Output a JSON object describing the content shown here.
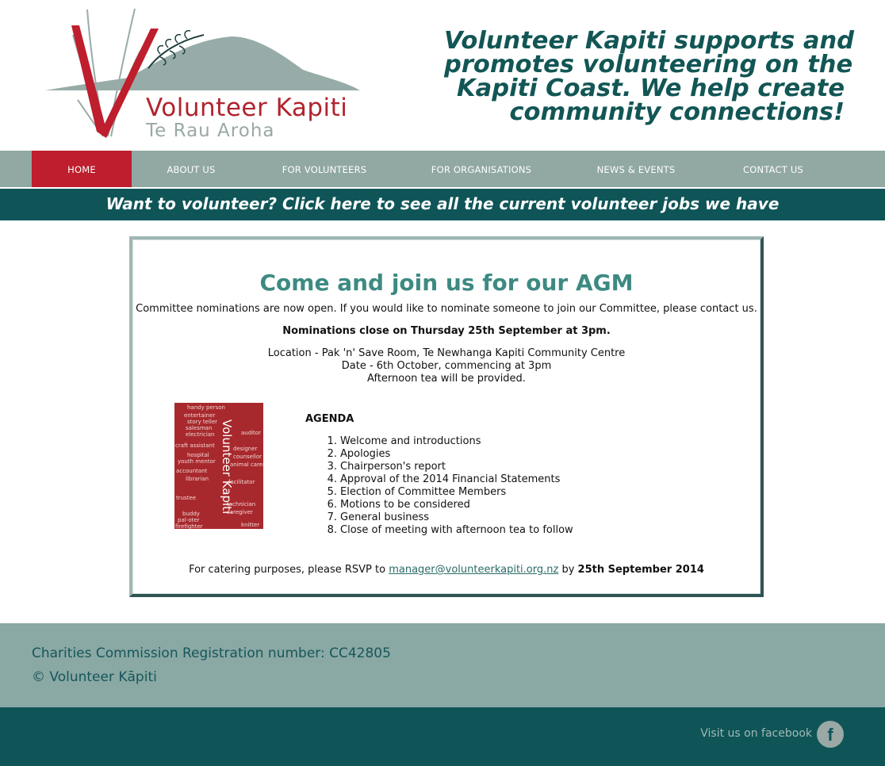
{
  "logo": {
    "title": "Volunteer Kapiti",
    "subtitle": "Te Rau Aroha"
  },
  "tagline": {
    "lines": [
      "Volunteer Kapiti supports and",
      "promotes volunteering on the",
      "Kapiti Coast. We help create",
      "community connections!"
    ]
  },
  "nav": {
    "items": [
      {
        "label": "HOME",
        "active": true
      },
      {
        "label": "ABOUT US"
      },
      {
        "label": "FOR VOLUNTEERS"
      },
      {
        "label": "FOR ORGANISATIONS"
      },
      {
        "label": "NEWS & EVENTS"
      },
      {
        "label": "CONTACT US"
      }
    ]
  },
  "banner": {
    "text": "Want to volunteer?  Click here to see all the current volunteer jobs we have"
  },
  "agm": {
    "title": "Come and join us for our AGM",
    "intro": "Committee nominations are now open. If you would like to nominate someone to join our Committee, please contact us.",
    "deadline": "Nominations close on Thursday 25th September at 3pm.",
    "location": "Location - Pak 'n' Save Room, Te Newhanga Kapiti Community Centre",
    "date": "Date - 6th October, commencing at 3pm",
    "tea": "Afternoon tea will be provided.",
    "agenda_heading": "AGENDA",
    "agenda": [
      "Welcome and introductions",
      "Apologies",
      "Chairperson's report",
      "Approval of the 2014 Financial Statements",
      "Election of Committee Members",
      "Motions to be considered",
      "General business",
      "Close of meeting with afternoon tea to follow"
    ],
    "rsvp_prefix": "For catering purposes, please RSVP to ",
    "rsvp_email": "manager@volunteerkapiti.org.nz",
    "rsvp_by": " by ",
    "rsvp_date": "25th September 2014"
  },
  "wordcloud": {
    "words": [
      "handy person",
      "entertainer",
      "story teller",
      "salesman",
      "electrician",
      "craft assistant",
      "hospital",
      "youth mentor",
      "accountant",
      "librarian",
      "trustee",
      "buddy",
      "pal-oter",
      "firefighter",
      "auditor",
      "designer",
      "counsellor",
      "animal carer",
      "facilitator",
      "technician",
      "caregiver",
      "knitter",
      "Volunteer Kapiti"
    ]
  },
  "footer": {
    "registration": "Charities Commission Registration number: CC42805",
    "copyright": "© Volunteer Kāpiti",
    "facebook_text": "Visit us on facebook",
    "facebook_icon": "f"
  },
  "colors": {
    "brand_red": "#be1e2d",
    "teal_dark": "#0f5558",
    "nav_grey": "#91a8a3",
    "heading_teal": "#3d8a82"
  }
}
